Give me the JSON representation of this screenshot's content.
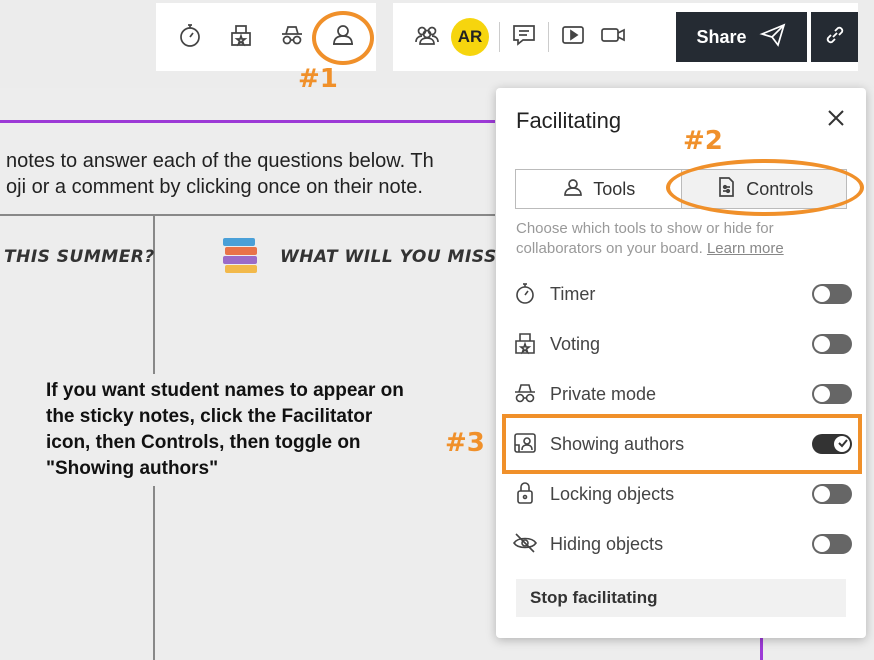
{
  "toolbar_left": {
    "icons": [
      "timer-icon",
      "voting-icon",
      "private-mode-icon",
      "facilitator-icon"
    ]
  },
  "toolbar_right": {
    "avatar_initials": "AR",
    "share_label": "Share"
  },
  "board": {
    "line1": "notes to answer each of the questions below.  Th",
    "line2": "oji or a comment by clicking once on their note.",
    "col1_header": "THIS SUMMER?",
    "col2_header": "WHAT WILL YOU MISS AB"
  },
  "instructions": "If you want student names to appear on the sticky notes, click the Facilitator icon, then Controls, then toggle on \"Showing authors\"",
  "annotations": {
    "a1": "#1",
    "a2": "#2",
    "a3": "#3",
    "color": "#f0902a"
  },
  "panel": {
    "title": "Facilitating",
    "tab_tools": "Tools",
    "tab_controls": "Controls",
    "description": "Choose which tools to show or hide for collaborators on your board.",
    "learn_more": "Learn more",
    "controls": [
      {
        "label": "Timer",
        "on": false,
        "icon": "timer-icon"
      },
      {
        "label": "Voting",
        "on": false,
        "icon": "voting-icon"
      },
      {
        "label": "Private mode",
        "on": false,
        "icon": "private-mode-icon"
      },
      {
        "label": "Showing authors",
        "on": true,
        "icon": "showing-authors-icon"
      },
      {
        "label": "Locking objects",
        "on": false,
        "icon": "lock-icon"
      },
      {
        "label": "Hiding objects",
        "on": false,
        "icon": "eye-off-icon"
      }
    ],
    "stop_label": "Stop facilitating"
  },
  "colors": {
    "accent_purple": "#9c3ad6",
    "share_bg": "#252b33",
    "avatar": "#f6d50e"
  }
}
